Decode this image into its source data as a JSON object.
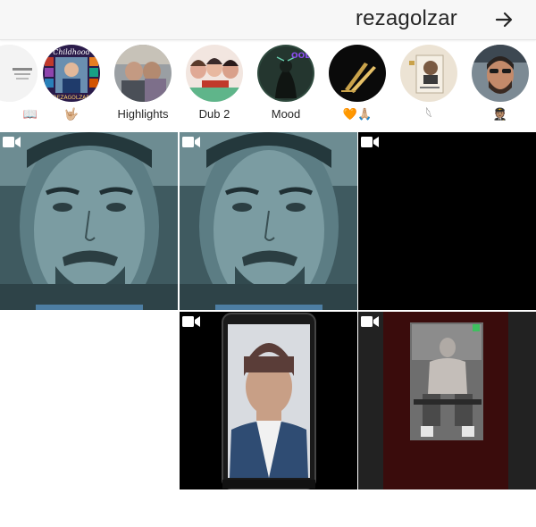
{
  "header": {
    "username": "rezagolzar",
    "next_icon": "arrow-right-icon"
  },
  "stories": [
    {
      "label": "📖",
      "thumb": "book-cover"
    },
    {
      "label": "🤟🏼",
      "thumb": "childhood-collage"
    },
    {
      "label": "Highlights",
      "thumb": "friends-photo"
    },
    {
      "label": "Dub 2",
      "thumb": "girls-group"
    },
    {
      "label": "Mood",
      "thumb": "mood-dark"
    },
    {
      "label": "🧡🙏🏼",
      "thumb": "gold-logo"
    },
    {
      "label": "𓆩",
      "thumb": "poster-portrait"
    },
    {
      "label": "🧑🏽‍✈️",
      "thumb": "selfie-beard"
    }
  ],
  "grid": {
    "cells": [
      {
        "type": "video",
        "thumb": "teal-portrait"
      },
      {
        "type": "video",
        "thumb": "teal-portrait"
      },
      {
        "type": "video",
        "thumb": "black"
      },
      {
        "type": "empty",
        "thumb": "blank"
      },
      {
        "type": "video",
        "thumb": "phone-selfie"
      },
      {
        "type": "video",
        "thumb": "gym-photo"
      }
    ]
  },
  "colors": {
    "header_bg": "#f7f7f7",
    "text": "#262626",
    "teal": "#5b7a80"
  }
}
